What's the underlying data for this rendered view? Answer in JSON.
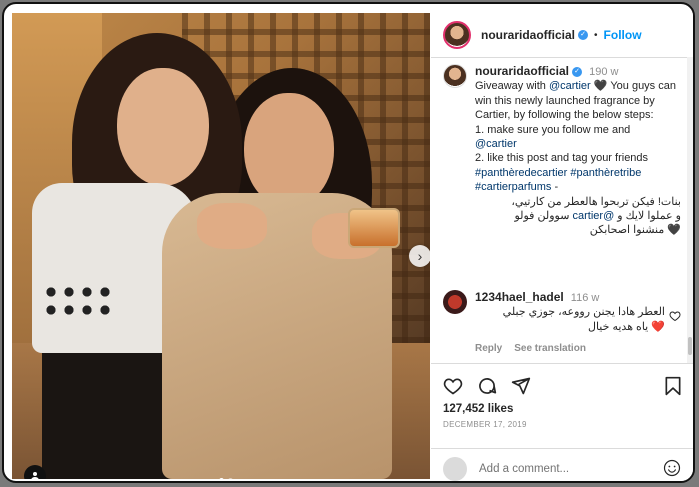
{
  "post": {
    "username": "nouraridaofficial",
    "follow_separator": "•",
    "follow_label": "Follow"
  },
  "caption": {
    "username": "nouraridaofficial",
    "age": "190 w",
    "line1": "Giveaway with ",
    "mention1": "@cartier",
    "line1b": " 🖤 You guys can win this newly launched fragrance by Cartier, by following the below steps:",
    "step1": "1. make sure you follow me and ",
    "mention2": "@cartier",
    "step2": "2. like this post and tag your friends",
    "hashtags": "#panthèredecartier #panthèretribe #cartierparfums",
    "hashtags_tail": " -",
    "arabic1": "بنات! فيكن تربحوا هالعطر من كارتيي،",
    "arabic2a": "و عملوا لايك و ",
    "arabic2_mention": "@cartier",
    "arabic2b": " سوولن فولو",
    "arabic3": "🖤 منشنوا اصحابكن"
  },
  "comment": {
    "username": "1234hael_hadel",
    "age": "116 w",
    "text1": "العطر هادا يجنن رووعه، جوزي جبلي",
    "text2": "❤️ ياه هديه خيال",
    "reply_label": "Reply",
    "translate_label": "See translation"
  },
  "stats": {
    "likes": "127,452 likes",
    "date": "DECEMBER 17, 2019"
  },
  "composer": {
    "placeholder": "Add a comment..."
  },
  "carousel": {
    "total": 2,
    "current": 1
  },
  "colors": {
    "accent": "#0095f6",
    "verified": "#3897f0",
    "meta_gray": "#8e8e8e"
  },
  "icons": [
    "verified-badge-icon",
    "chevron-right-icon",
    "user-tag-icon",
    "heart-icon",
    "comment-icon",
    "share-icon",
    "bookmark-icon",
    "emoji-icon"
  ]
}
